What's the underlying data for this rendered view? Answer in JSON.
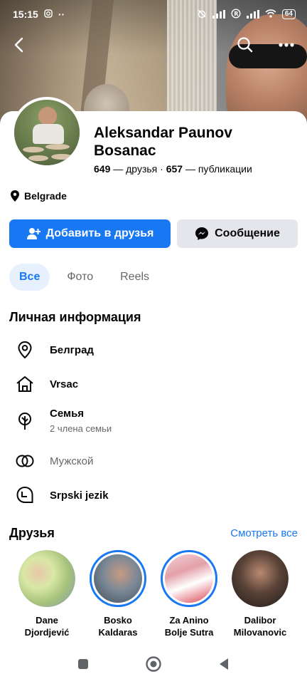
{
  "status_bar": {
    "time": "15:15",
    "battery": "64"
  },
  "profile": {
    "name": "Aleksandar Paunov Bosanac",
    "friends_count": "649",
    "friends_label": "— друзья",
    "separator": "·",
    "posts_count": "657",
    "posts_label": "— публикации",
    "location": "Belgrade"
  },
  "actions": {
    "add_friend_label": "Добавить в друзья",
    "message_label": "Сообщение"
  },
  "tabs": [
    {
      "label": "Все",
      "active": true
    },
    {
      "label": "Фото",
      "active": false
    },
    {
      "label": "Reels",
      "active": false
    }
  ],
  "personal_info": {
    "title": "Личная информация",
    "items": [
      {
        "icon": "location-pin-icon",
        "text": "Белград"
      },
      {
        "icon": "home-icon",
        "text": "Vrsac"
      },
      {
        "icon": "family-tree-icon",
        "text": "Семья",
        "sub": "2 члена семьи"
      },
      {
        "icon": "gender-icon",
        "text": "Мужской"
      },
      {
        "icon": "language-bubble-icon",
        "text": "Srpski jezik"
      }
    ]
  },
  "friends": {
    "title": "Друзья",
    "see_all": "Смотреть все",
    "items": [
      {
        "name_line1": "Dane",
        "name_line2": "Djordjević"
      },
      {
        "name_line1": "Bosko",
        "name_line2": "Kaldaras"
      },
      {
        "name_line1": "Za Anino",
        "name_line2": "Bolje Sutra"
      },
      {
        "name_line1": "Dalibor",
        "name_line2": "Milovanovic"
      }
    ]
  },
  "colors": {
    "accent": "#1877f2",
    "secondary_button": "#e4e6eb",
    "muted_text": "#65676b"
  }
}
